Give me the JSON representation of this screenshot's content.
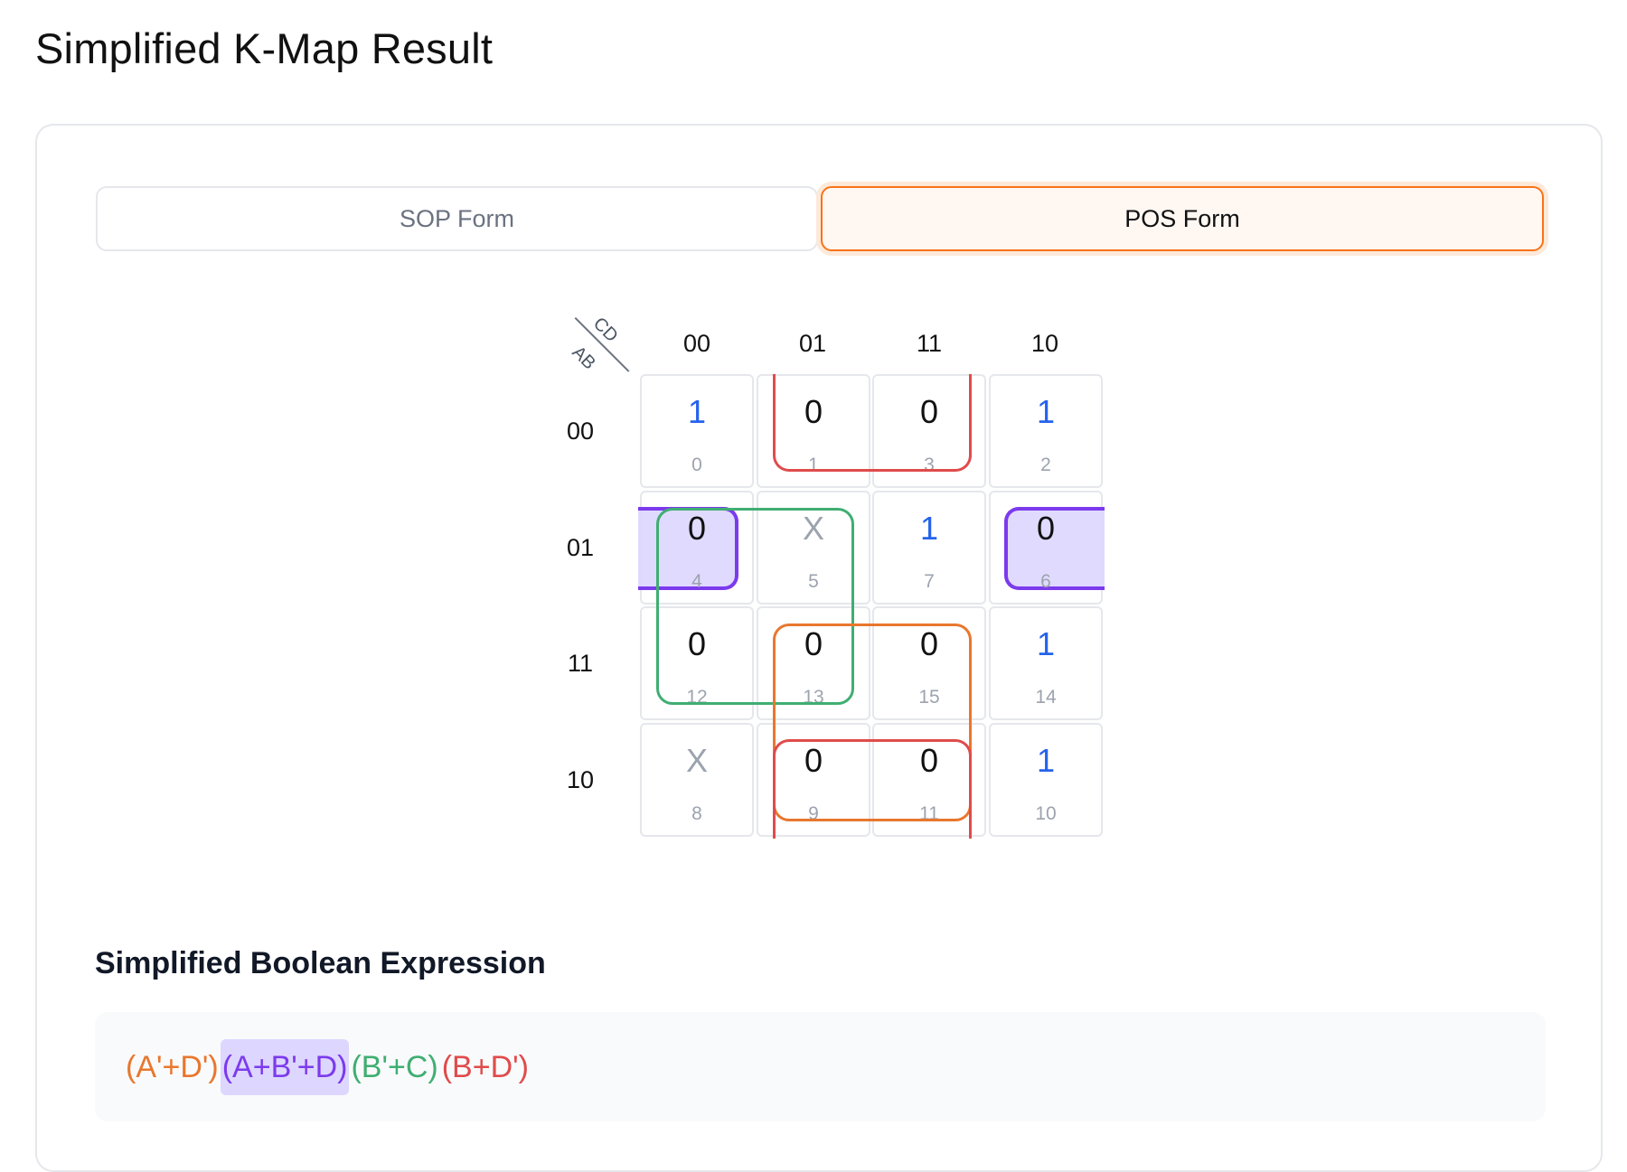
{
  "page": {
    "title": "Simplified K-Map Result"
  },
  "tabs": [
    {
      "label": "SOP Form",
      "active": false
    },
    {
      "label": "POS Form",
      "active": true
    }
  ],
  "kmap": {
    "corner": {
      "cols_var": "CD",
      "rows_var": "AB"
    },
    "col_labels": [
      "00",
      "01",
      "11",
      "10"
    ],
    "row_labels": [
      "00",
      "01",
      "11",
      "10"
    ],
    "cells": [
      [
        {
          "value": "1",
          "index": "0"
        },
        {
          "value": "0",
          "index": "1"
        },
        {
          "value": "0",
          "index": "3"
        },
        {
          "value": "1",
          "index": "2"
        }
      ],
      [
        {
          "value": "0",
          "index": "4"
        },
        {
          "value": "X",
          "index": "5"
        },
        {
          "value": "1",
          "index": "7"
        },
        {
          "value": "0",
          "index": "6"
        }
      ],
      [
        {
          "value": "0",
          "index": "12"
        },
        {
          "value": "0",
          "index": "13"
        },
        {
          "value": "0",
          "index": "15"
        },
        {
          "value": "1",
          "index": "14"
        }
      ],
      [
        {
          "value": "X",
          "index": "8"
        },
        {
          "value": "0",
          "index": "9"
        },
        {
          "value": "0",
          "index": "11"
        },
        {
          "value": "1",
          "index": "10"
        }
      ]
    ],
    "colors": {
      "one": "#2563eb",
      "zero": "#111111",
      "dont_care": "#9ca3af",
      "orange": "#e8772e",
      "purple": "#7c3aed",
      "purple_fill": "#ddd6fe",
      "green": "#3fae72",
      "red": "#e04b4b"
    }
  },
  "expression": {
    "title": "Simplified Boolean Expression",
    "terms": [
      {
        "text": "(A'+D')",
        "color": "orange"
      },
      {
        "text": "(A+B'+D)",
        "color": "purple"
      },
      {
        "text": "(B'+C)",
        "color": "green"
      },
      {
        "text": "(B+D')",
        "color": "red"
      }
    ]
  }
}
